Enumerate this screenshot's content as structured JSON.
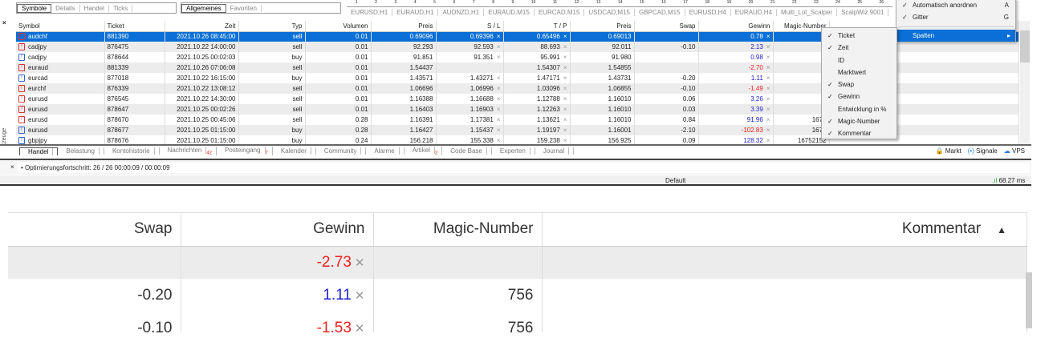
{
  "nav_tabs": [
    "Symbole",
    "Details",
    "Handel",
    "Ticks"
  ],
  "mw_tabs": [
    "Allgemeines",
    "Favoriten"
  ],
  "ruler": [
    "1",
    "2",
    "3",
    "4",
    "5",
    "6",
    "7",
    "8",
    "9",
    "10",
    "11",
    "12",
    "13",
    "14",
    "15",
    "16",
    "17",
    "18",
    "19",
    "20",
    "21",
    "22",
    "23",
    "24",
    "25",
    "26"
  ],
  "chart_tabs": [
    "EURUSD,H1",
    "EURAUD,H1",
    "AUDNZD,H1",
    "EURAUD,M15",
    "EURCAD,M15",
    "USDCAD,M15",
    "GBPCAD,M15",
    "EURUSD,H4",
    "EURAUD,H4",
    "Multi_Lot_Scalper",
    "ScalpWiz 9001"
  ],
  "context_menu": {
    "items": [
      {
        "label": "Automatisch anordnen",
        "shortcut": "A",
        "checked": true
      },
      {
        "label": "Gitter",
        "shortcut": "G",
        "checked": true
      }
    ],
    "submenu_label": "Spalten"
  },
  "columns_menu": [
    {
      "label": "Ticket",
      "checked": true
    },
    {
      "label": "Zeit",
      "checked": true
    },
    {
      "label": "ID",
      "checked": false
    },
    {
      "label": "Marktwert",
      "checked": false
    },
    {
      "label": "Swap",
      "checked": true
    },
    {
      "label": "Gewinn",
      "checked": true
    },
    {
      "label": "Entwicklung in %",
      "checked": false
    },
    {
      "label": "Magic-Number",
      "checked": true
    },
    {
      "label": "Kommentar",
      "checked": true
    }
  ],
  "headers": [
    "Symbol",
    "Ticket",
    "Zeit",
    "Typ",
    "Volumen",
    "Preis",
    "S / L",
    "T / P",
    "Preis",
    "Swap",
    "Gewinn",
    "Magic-Number"
  ],
  "rows": [
    [
      "audchf",
      "881390",
      "2021.10.26 08:45:00",
      "sell",
      "0.01",
      "0.69096",
      "0.69396",
      "0.65496",
      "0.69013",
      "",
      "0.78",
      ""
    ],
    [
      "cadjpy",
      "876475",
      "2021.10.22 14:00:00",
      "sell",
      "0.01",
      "92.293",
      "92.593",
      "88.693",
      "92.011",
      "-0.10",
      "2.13",
      ""
    ],
    [
      "cadjpy",
      "878644",
      "2021.10.25 00:02:03",
      "buy",
      "0.01",
      "91.851",
      "91.351",
      "95.991",
      "91.980",
      "",
      "0.98",
      "7"
    ],
    [
      "euraud",
      "881339",
      "2021.10.26 07:06:08",
      "sell",
      "0.01",
      "1.54437",
      "",
      "1.54307",
      "1.54855",
      "",
      "-2.70",
      ""
    ],
    [
      "eurcad",
      "877018",
      "2021.10.22 16:15:00",
      "buy",
      "0.01",
      "1.43571",
      "1.43271",
      "1.47171",
      "1.43731",
      "-0.20",
      "1.11",
      ""
    ],
    [
      "eurchf",
      "876339",
      "2021.10.22 13:08:12",
      "sell",
      "0.01",
      "1.06696",
      "1.06996",
      "1.03096",
      "1.06855",
      "-0.10",
      "-1.49",
      ""
    ],
    [
      "eurusd",
      "876545",
      "2021.10.22 14:30:00",
      "sell",
      "0.01",
      "1.16388",
      "1.16688",
      "1.12788",
      "1.16010",
      "0.06",
      "3.26",
      ""
    ],
    [
      "eurusd",
      "878647",
      "2021.10.25 00:02:26",
      "sell",
      "0.01",
      "1.16403",
      "1.16903",
      "1.12263",
      "1.16010",
      "0.03",
      "3.39",
      "7"
    ],
    [
      "eurusd",
      "878670",
      "2021.10.25 00:45:06",
      "sell",
      "0.28",
      "1.16391",
      "1.17381",
      "1.13621",
      "1.16010",
      "0.84",
      "91.96",
      "1675"
    ],
    [
      "eurusd",
      "878677",
      "2021.10.25 01:15:00",
      "buy",
      "0.28",
      "1.16427",
      "1.15437",
      "1.19197",
      "1.16001",
      "-2.10",
      "-102.83",
      "1675"
    ],
    [
      "gbpjpy",
      "878676",
      "2021.10.25 01:15:00",
      "buy",
      "0.24",
      "156.218",
      "155.338",
      "159.238",
      "156.925",
      "0.09",
      "128.32",
      "16752152"
    ]
  ],
  "vertical_label": "Werkzeuge",
  "bottom_tabs": [
    {
      "label": "Handel"
    },
    {
      "label": "Belastung"
    },
    {
      "label": "Kontohistorie"
    },
    {
      "label": "Nachrichten",
      "badge": "42"
    },
    {
      "label": "Posteingang",
      "badge": "7"
    },
    {
      "label": "Kalender"
    },
    {
      "label": "Community"
    },
    {
      "label": "Alarme"
    },
    {
      "label": "Artikel",
      "badge": "2"
    },
    {
      "label": "Code Base"
    },
    {
      "label": "Experten"
    },
    {
      "label": "Journal"
    }
  ],
  "right_links": [
    "Markt",
    "Signale",
    "VPS"
  ],
  "output_line": "Optimierungsfortschritt: 26 / 26   00:00:09 / 00:00:09",
  "status": {
    "profile": "Default",
    "ping": "68.27 ms"
  },
  "zoom_view": {
    "headers": [
      "Swap",
      "Gewinn",
      "Magic-Number",
      "Kommentar"
    ],
    "rows": [
      [
        "",
        "-2.73",
        ""
      ],
      [
        "-0.20",
        "1.11",
        "756"
      ],
      [
        "-0.10",
        "-1.53",
        "756"
      ]
    ]
  }
}
